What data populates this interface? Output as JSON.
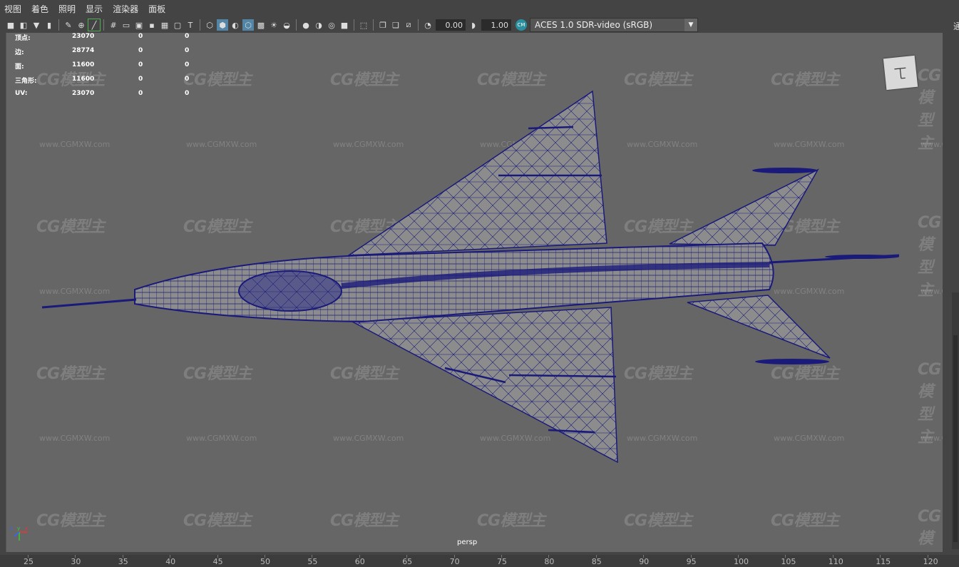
{
  "menu": [
    "视图",
    "着色",
    "照明",
    "显示",
    "渲染器",
    "面板"
  ],
  "toolbar": {
    "field1": "0.00",
    "field2": "1.00",
    "color_space": "ACES 1.0 SDR-video (sRGB)",
    "cm_icon": "CM"
  },
  "hud": {
    "rows": [
      {
        "label": "顶点:",
        "v1": "23070",
        "v2": "0",
        "v3": "0"
      },
      {
        "label": "边:",
        "v1": "28774",
        "v2": "0",
        "v3": "0"
      },
      {
        "label": "面:",
        "v1": "11600",
        "v2": "0",
        "v3": "0"
      },
      {
        "label": "三角形:",
        "v1": "11600",
        "v2": "0",
        "v3": "0"
      },
      {
        "label": "UV:",
        "v1": "23070",
        "v2": "0",
        "v3": "0"
      }
    ]
  },
  "viewport": {
    "camera": "persp",
    "axis_labels": {
      "x": "x",
      "y": "y",
      "z": "z"
    }
  },
  "watermark": {
    "logo": "CG模型主",
    "url": "www.CGMXW.com"
  },
  "right_panel": {
    "text": "通"
  },
  "timeline": {
    "ticks": [
      "25",
      "30",
      "35",
      "40",
      "45",
      "50",
      "55",
      "60",
      "65",
      "70",
      "75",
      "80",
      "85",
      "90",
      "95",
      "100",
      "105",
      "110",
      "115",
      "120"
    ]
  },
  "colors": {
    "wire": "#1a1a7a",
    "mesh_fill": "#8c8c8c",
    "viewport_bg": "#666666"
  }
}
